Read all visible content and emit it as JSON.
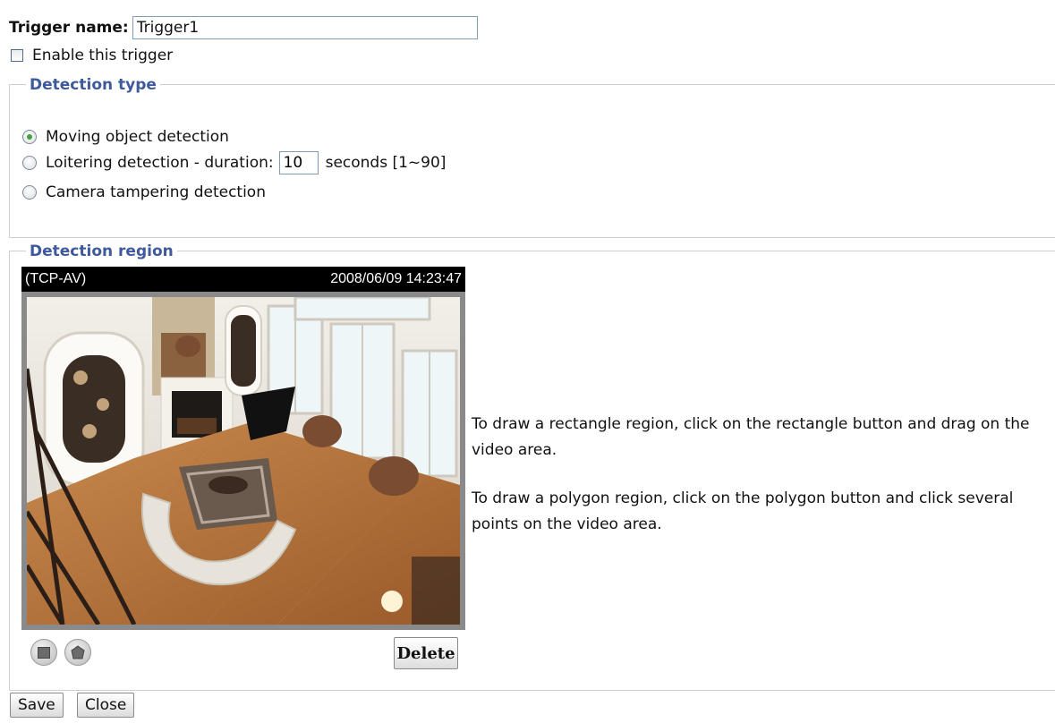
{
  "trigger": {
    "name_label": "Trigger name:",
    "name_value": "Trigger1",
    "enable_label": "Enable this trigger",
    "enable_checked": false
  },
  "detection_type": {
    "legend": "Detection type",
    "options": [
      {
        "label": "Moving object detection",
        "checked": true
      },
      {
        "label": "Loitering detection - duration:",
        "checked": false
      },
      {
        "label": "Camera tampering detection",
        "checked": false
      }
    ],
    "duration_value": "10",
    "duration_suffix": "seconds [1~90]"
  },
  "detection_region": {
    "legend": "Detection region",
    "video": {
      "stream_label": "(TCP-AV)",
      "timestamp": "2008/06/09 14:23:47"
    },
    "delete_label": "Delete",
    "tools": [
      "rectangle-icon",
      "polygon-icon"
    ],
    "help_rectangle": "To draw a rectangle region, click on the rectangle button and drag on the video area.",
    "help_polygon": "To draw a polygon region, click on the polygon button and click several points on the video area."
  },
  "footer": {
    "save_label": "Save",
    "close_label": "Close"
  },
  "colors": {
    "legend": "#3e5a9c",
    "radio_checked": "#3fa33f"
  }
}
